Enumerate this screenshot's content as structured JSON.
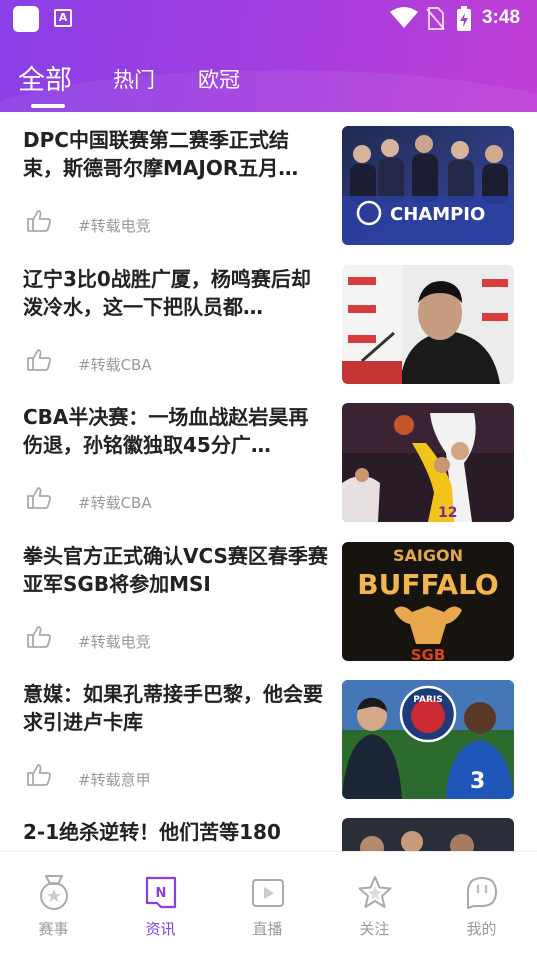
{
  "status_bar": {
    "time": "3:48",
    "icons": [
      "app-icon",
      "a-icon",
      "wifi-icon",
      "no-sim-icon",
      "battery-charging-icon"
    ]
  },
  "tabs": [
    {
      "label": "全部",
      "active": true
    },
    {
      "label": "热门",
      "active": false
    },
    {
      "label": "欧冠",
      "active": false
    }
  ],
  "news": [
    {
      "title": "DPC中国联赛第二赛季正式结束，斯德哥尔摩MAJOR五月…",
      "tag": "#转载电竞",
      "thumb_text": "CHAMPIO"
    },
    {
      "title": "辽宁3比0战胜广厦，杨鸣赛后却泼冷水，这一下把队员都…",
      "tag": "#转载CBA"
    },
    {
      "title": "CBA半决赛：一场血战赵岩昊再伤退，孙铭徽独取45分广…",
      "tag": "#转载CBA"
    },
    {
      "title": "拳头官方正式确认VCS赛区春季赛亚军SGB将参加MSI",
      "tag": "#转载电竞",
      "thumb_text": "SAIGON BUFFALO",
      "thumb_sub": "SGB"
    },
    {
      "title": "意媒：如果孔蒂接手巴黎，他会要求引进卢卡库",
      "tag": "#转载意甲",
      "thumb_text": "PARIS"
    },
    {
      "title": "2-1绝杀逆转！他们苦等180",
      "tag": ""
    }
  ],
  "bottom_nav": [
    {
      "label": "赛事",
      "icon": "medal-icon",
      "active": false
    },
    {
      "label": "资讯",
      "icon": "news-icon",
      "active": true
    },
    {
      "label": "直播",
      "icon": "play-icon",
      "active": false
    },
    {
      "label": "关注",
      "icon": "star-icon",
      "active": false
    },
    {
      "label": "我的",
      "icon": "profile-icon",
      "active": false
    }
  ],
  "colors": {
    "accent": "#8a3fe6",
    "header_start": "#8a3fe6",
    "header_end": "#c03fd6",
    "tag_gray": "#9a9a9a"
  }
}
